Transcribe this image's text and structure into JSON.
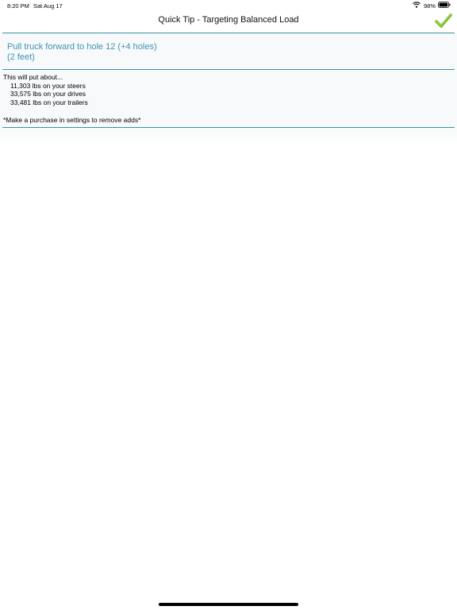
{
  "status_bar": {
    "time": "8:20 PM",
    "date": "Sat Aug 17",
    "battery_percent": "98%",
    "icons": [
      "wifi-icon",
      "battery-icon"
    ]
  },
  "nav": {
    "title": "Quick Tip - Targeting Balanced Load",
    "done_icon": "checkmark-icon"
  },
  "tip": {
    "action_line1": "Pull truck forward to hole 12 (+4 holes)",
    "action_line2": "(2 feet)",
    "intro": "This will put about...",
    "steers": "11,303 lbs on your steers",
    "drives": "33,575 lbs on your drives",
    "trailers": "33,481 lbs on your trailers",
    "ad_note": "*Make a purchase in settings to remove adds*"
  },
  "colors": {
    "accent": "#3d94b3",
    "divider": "#3b91a8",
    "check_green": "#78b51e"
  }
}
